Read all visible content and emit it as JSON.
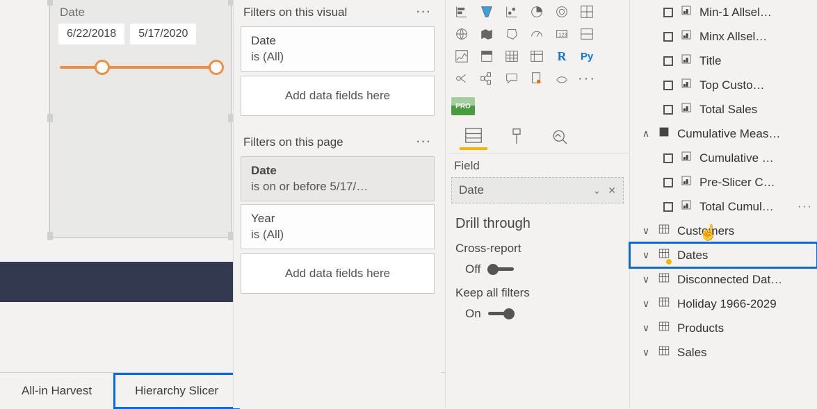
{
  "slicer": {
    "title": "Date",
    "date_from": "6/22/2018",
    "date_to": "5/17/2020"
  },
  "tabs": {
    "t1": "All-in Harvest",
    "t2": "Hierarchy Slicer",
    "add": "+"
  },
  "filters": {
    "visual_head": "Filters on this visual",
    "page_head": "Filters on this page",
    "date": {
      "title": "Date",
      "sub": "is (All)"
    },
    "drop": "Add data fields here",
    "datep": {
      "title": "Date",
      "sub": "is on or before 5/17/…"
    },
    "year": {
      "title": "Year",
      "sub": "is (All)"
    }
  },
  "viz": {
    "field_label": "Field",
    "field_value": "Date",
    "drill_head": "Drill through",
    "cross": "Cross-report",
    "off": "Off",
    "keep": "Keep all filters",
    "on": "On",
    "more": "···"
  },
  "fields": {
    "min1": "Min-1 Allsel…",
    "minx": "Minx Allsel…",
    "title": "Title",
    "topc": "Top Custo…",
    "totals": "Total Sales",
    "cumg": "Cumulative Meas…",
    "cum": "Cumulative …",
    "pre": "Pre-Slicer C…",
    "totc": "Total Cumul…",
    "cust": "Customers",
    "dates": "Dates",
    "disc": "Disconnected Dat…",
    "hol": "Holiday 1966-2029",
    "prod": "Products",
    "sales": "Sales"
  },
  "pro": "PRO"
}
